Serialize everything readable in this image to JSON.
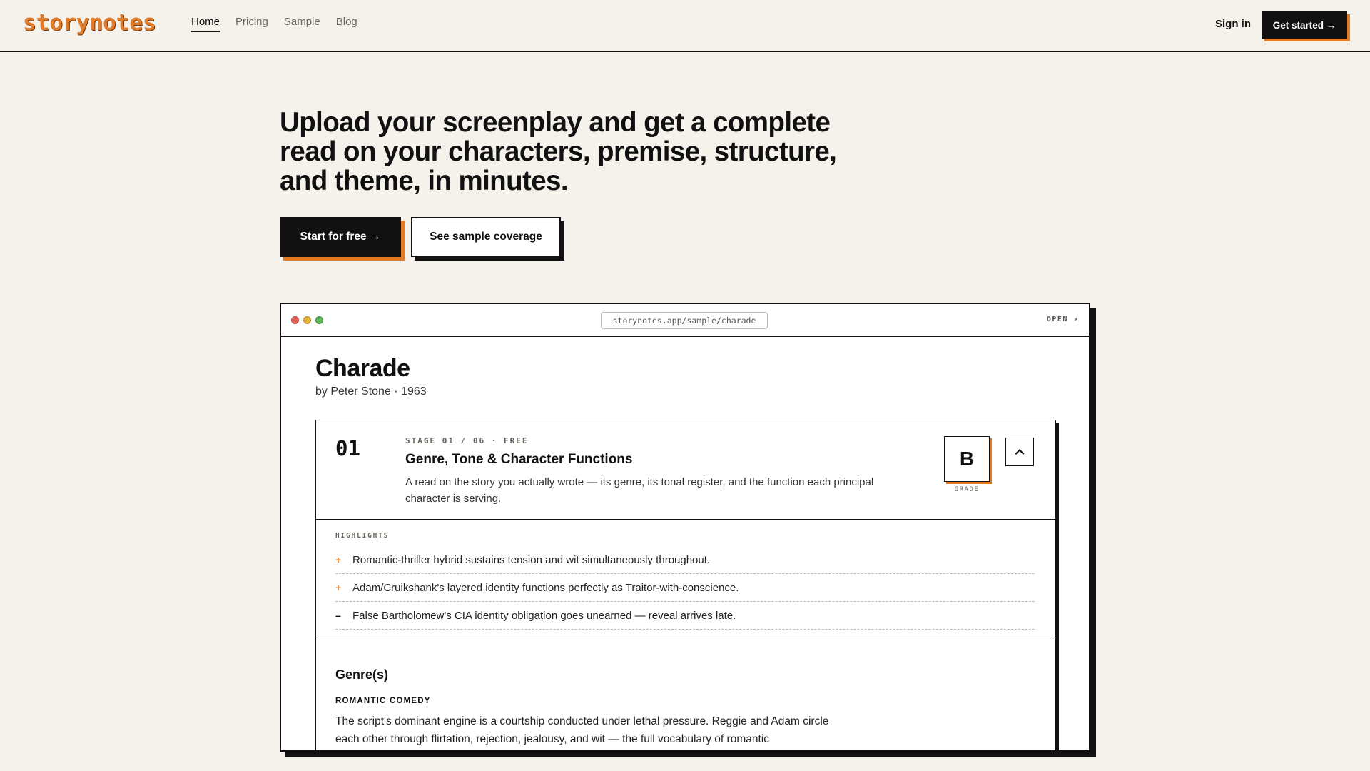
{
  "nav": {
    "logo": "storynotes",
    "links": [
      {
        "label": "Home",
        "active": true
      },
      {
        "label": "Pricing",
        "active": false
      },
      {
        "label": "Sample",
        "active": false
      },
      {
        "label": "Blog",
        "active": false
      }
    ],
    "sign_in": "Sign in",
    "get_started": "Get started →"
  },
  "hero": {
    "title": "Upload your screenplay and get a complete read on your characters, premise, structure, and theme, in minutes.",
    "primary_cta": "Start for free →",
    "secondary_cta": "See sample coverage"
  },
  "window": {
    "url": "storynotes.app/sample/charade",
    "open_label": "OPEN ↗",
    "doc": {
      "title": "Charade",
      "byline": "by Peter Stone · 1963"
    },
    "stage": {
      "number": "01",
      "meta": "STAGE 01 / 06 · FREE",
      "title": "Genre, Tone & Character Functions",
      "description": "A read on the story you actually wrote — its genre, its tonal register, and the function each principal character is serving.",
      "grade": "B",
      "grade_label": "GRADE",
      "highlights_label": "HIGHLIGHTS",
      "highlights": [
        {
          "mark": "+",
          "text": "Romantic-thriller hybrid sustains tension and wit simultaneously throughout."
        },
        {
          "mark": "+",
          "text": "Adam/Cruikshank's layered identity functions perfectly as Traitor-with-conscience."
        },
        {
          "mark": "–",
          "text": "False Bartholomew's CIA identity obligation goes unearned — reveal arrives late."
        }
      ],
      "section_heading": "Genre(s)",
      "section_sub": "ROMANTIC COMEDY",
      "section_body": "The script's dominant engine is a courtship conducted under lethal pressure. Reggie and Adam circle each other through flirtation, rejection, jealousy, and wit — the full vocabulary of romantic"
    }
  },
  "colors": {
    "accent": "#e07b2a",
    "background": "#f5f2ec",
    "ink": "#111111"
  }
}
